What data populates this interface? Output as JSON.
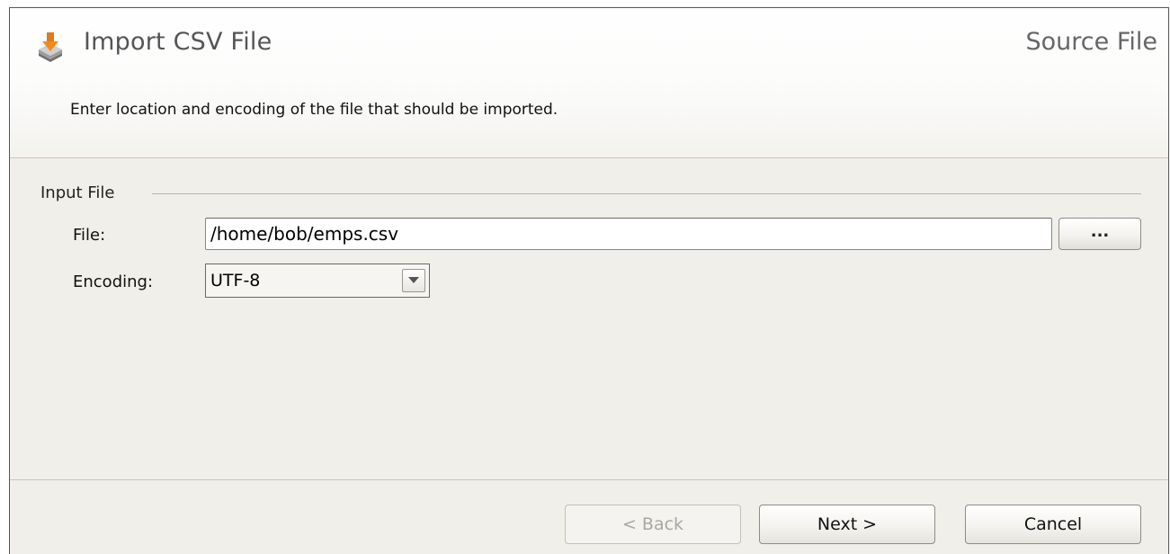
{
  "header": {
    "title": "Import CSV File",
    "page_name": "Source File",
    "description": "Enter location and encoding of the file that should be imported.",
    "icon": "import-icon"
  },
  "input_group": {
    "title": "Input File",
    "file_label": "File:",
    "file_value": "/home/bob/emps.csv",
    "browse_label": "...",
    "encoding_label": "Encoding:",
    "encoding_value": "UTF-8"
  },
  "buttons": {
    "back": "< Back",
    "next": "Next >",
    "cancel": "Cancel"
  }
}
